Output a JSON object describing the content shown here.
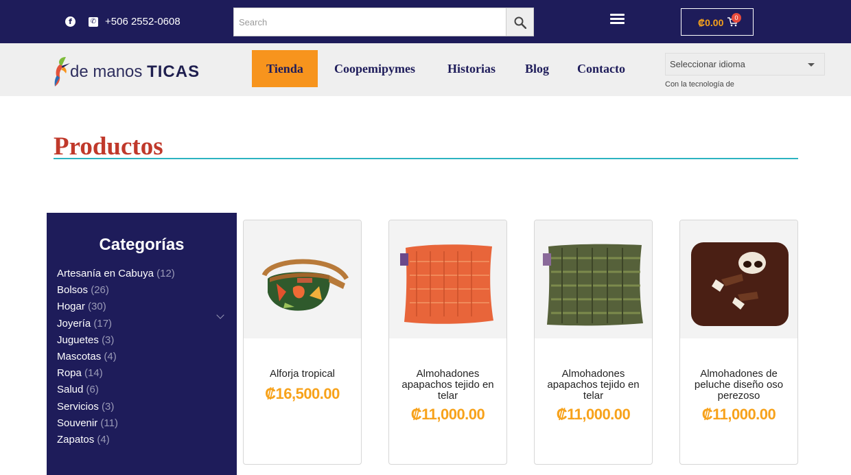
{
  "header": {
    "phone": "+506 2552-0608",
    "search_placeholder": "Search",
    "cart_total": "₡0.00",
    "cart_count": "0",
    "facebook_icon": "facebook-icon",
    "phone_icon": "phone-icon",
    "search_icon": "search-icon",
    "menu_icon": "hamburger-menu-icon",
    "cart_icon": "cart-icon"
  },
  "brand": {
    "logo_light": "de manos",
    "logo_bold": "TICAS"
  },
  "nav": {
    "items": [
      {
        "label": "Tienda",
        "active": true
      },
      {
        "label": "Coopemipymes",
        "active": false
      },
      {
        "label": "Historias",
        "active": false
      },
      {
        "label": "Blog",
        "active": false
      },
      {
        "label": "Contacto",
        "active": false
      }
    ]
  },
  "language": {
    "selected": "Seleccionar idioma",
    "powered_by": "Con la tecnología de"
  },
  "page": {
    "title": "Productos"
  },
  "sidebar": {
    "title": "Categorías",
    "categories": [
      {
        "name": "Artesanía en Cabuya",
        "count": "(12)"
      },
      {
        "name": "Bolsos",
        "count": "(26)"
      },
      {
        "name": "Hogar",
        "count": "(30)"
      },
      {
        "name": "Joyería",
        "count": "(17)"
      },
      {
        "name": "Juguetes",
        "count": "(3)"
      },
      {
        "name": "Mascotas",
        "count": "(4)"
      },
      {
        "name": "Ropa",
        "count": "(14)"
      },
      {
        "name": "Salud",
        "count": "(6)"
      },
      {
        "name": "Servicios",
        "count": "(3)"
      },
      {
        "name": "Souvenir",
        "count": "(11)"
      },
      {
        "name": "Zapatos",
        "count": "(4)"
      }
    ]
  },
  "products": [
    {
      "name": "Alforja tropical",
      "price": "₡16,500.00"
    },
    {
      "name": "Almohadones apapachos tejido en telar",
      "price": "₡11,000.00"
    },
    {
      "name": "Almohadones apapachos tejido en telar",
      "price": "₡11,000.00"
    },
    {
      "name": "Almohadones de peluche diseño oso perezoso",
      "price": "₡11,000.00"
    }
  ],
  "colors": {
    "primary": "#1e1c5a",
    "accent": "#f7941d",
    "price": "#f7a21b",
    "title": "#c0392b",
    "underline": "#2bb3c0"
  }
}
